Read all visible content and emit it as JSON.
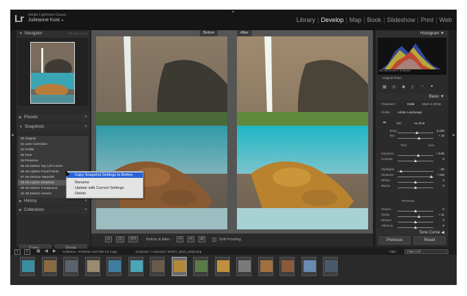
{
  "app": {
    "logo": "Lr",
    "product": "Adobe Lightroom Classic",
    "user": "Julieanne Kost",
    "user_arrow": "▼"
  },
  "modules": [
    "Library",
    "Develop",
    "Map",
    "Book",
    "Slideshow",
    "Print",
    "Web"
  ],
  "active_module": "Develop",
  "left_panel": {
    "navigator": "Navigator",
    "navigator_opts": "FIT   FILL   1:1   1:1",
    "presets": "Presets",
    "snapshots": "Snapshots",
    "snapshot_items": [
      "00 Original",
      "01 Lens Correction",
      "02 Profile",
      "03 Tone",
      "04 Presence",
      "05 AB Darken Top Left Corner",
      "06 AB Lighten Focal Points",
      "07 AB Dehaze Waterfall",
      "08 AB Lighten Shadows",
      "09 AB Darken Foreground",
      "10 AB Darken corners"
    ],
    "history": "History",
    "collections": "Collections",
    "copy_btn": "Copy...",
    "paste_btn": "Paste"
  },
  "context_menu": [
    "Copy Snapshot Settings to Before",
    "Rename",
    "Update with Current Settings",
    "Delete"
  ],
  "center": {
    "before_label": "Before",
    "after_label": "After",
    "yy_label": "Y|Y",
    "before_after_label": "Before & After :",
    "soft_proofing": "Soft Proofing"
  },
  "right_panel": {
    "histogram": "Histogram",
    "hist_meta": "ISO 100      24 mm      f / 11      60 sec",
    "original_photo": "Original Photo",
    "basic": "Basic",
    "treatment_label": "Treatment :",
    "treatment_color": "Color",
    "treatment_bw": "Black & White",
    "profile_label": "Profile :",
    "profile_value": "Adobe Landscape",
    "wb_label": "WB :",
    "wb_value": "As Shot",
    "temp": {
      "label": "Temp",
      "value": "5,150"
    },
    "tint": {
      "label": "Tint",
      "value": "+ 18"
    },
    "tone_label": "Tone",
    "auto": "Auto",
    "sliders_tone": [
      {
        "label": "Exposure",
        "value": "+ 0.60",
        "pos": 0.58
      },
      {
        "label": "Contrast",
        "value": "0",
        "pos": 0.5
      }
    ],
    "sliders_light": [
      {
        "label": "Highlights",
        "value": "- 82",
        "pos": 0.1
      },
      {
        "label": "Shadows",
        "value": "+ 100",
        "pos": 0.95
      },
      {
        "label": "Whites",
        "value": "0",
        "pos": 0.5
      },
      {
        "label": "Blacks",
        "value": "0",
        "pos": 0.5
      }
    ],
    "presence": "Presence",
    "sliders_presence": [
      {
        "label": "Texture",
        "value": "0",
        "pos": 0.5
      },
      {
        "label": "Clarity",
        "value": "+ 21",
        "pos": 0.6
      },
      {
        "label": "Dehaze",
        "value": "0",
        "pos": 0.5
      },
      {
        "label": "Vibrance",
        "value": "0",
        "pos": 0.5
      },
      {
        "label": "Saturation",
        "value": "0",
        "pos": 0.5
      }
    ],
    "tone_curve": "Tone Curve",
    "previous_btn": "Previous",
    "reset_btn": "Reset"
  },
  "filmstrip": {
    "page1": "1",
    "page2": "2",
    "source": "Collection : 00 Before and After LR Copy",
    "count": "15 photos / 1 selected / JKOST_2018_14325.dng",
    "filter_label": "Filter :",
    "filter_value": "Filters Off",
    "thumb_count": 15,
    "selected_index": 7
  },
  "colors": {
    "menu_highlight": "#2a63d6",
    "panel_bg": "#2b2b2b",
    "center_bg": "#555555"
  }
}
